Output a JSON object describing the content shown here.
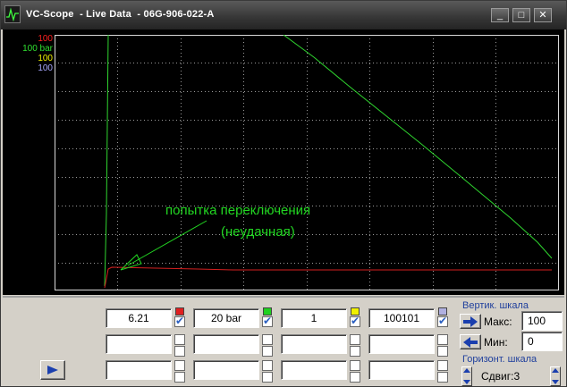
{
  "window": {
    "title": "VC-Scope  - Live Data  - 06G-906-022-A",
    "buttons": {
      "minimize": "_",
      "maximize": "□",
      "close": "✕"
    }
  },
  "legend": [
    {
      "label": "100",
      "color": "#ff2020"
    },
    {
      "label": "100 bar",
      "color": "#30e030"
    },
    {
      "label": "100",
      "color": "#f0f000"
    },
    {
      "label": "100",
      "color": "#a8a8ff"
    }
  ],
  "annotation": {
    "line1": "попытка переключения",
    "line2": "(неудачная)",
    "color": "#22d622"
  },
  "channels": [
    {
      "value": "6.21",
      "color": "#e02020",
      "checked": true
    },
    {
      "value": "20 bar",
      "color": "#20d020",
      "checked": true
    },
    {
      "value": "1",
      "color": "#f0f000",
      "checked": true
    },
    {
      "value": "100101",
      "color": "#b0b0e0",
      "checked": true
    }
  ],
  "vertical_scale": {
    "title": "Вертик. шкала",
    "max_label": "Макс:",
    "max_value": "100",
    "min_label": "Мин:",
    "min_value": "0"
  },
  "horizontal_scale": {
    "title": "Горизонт. шкала",
    "shift_text": "Сдвиг:3"
  },
  "colors": {
    "trace_green": "#2fd52f",
    "trace_red": "#d42020",
    "grid": "#9a9a9a",
    "accent_blue": "#1b3fae"
  }
}
